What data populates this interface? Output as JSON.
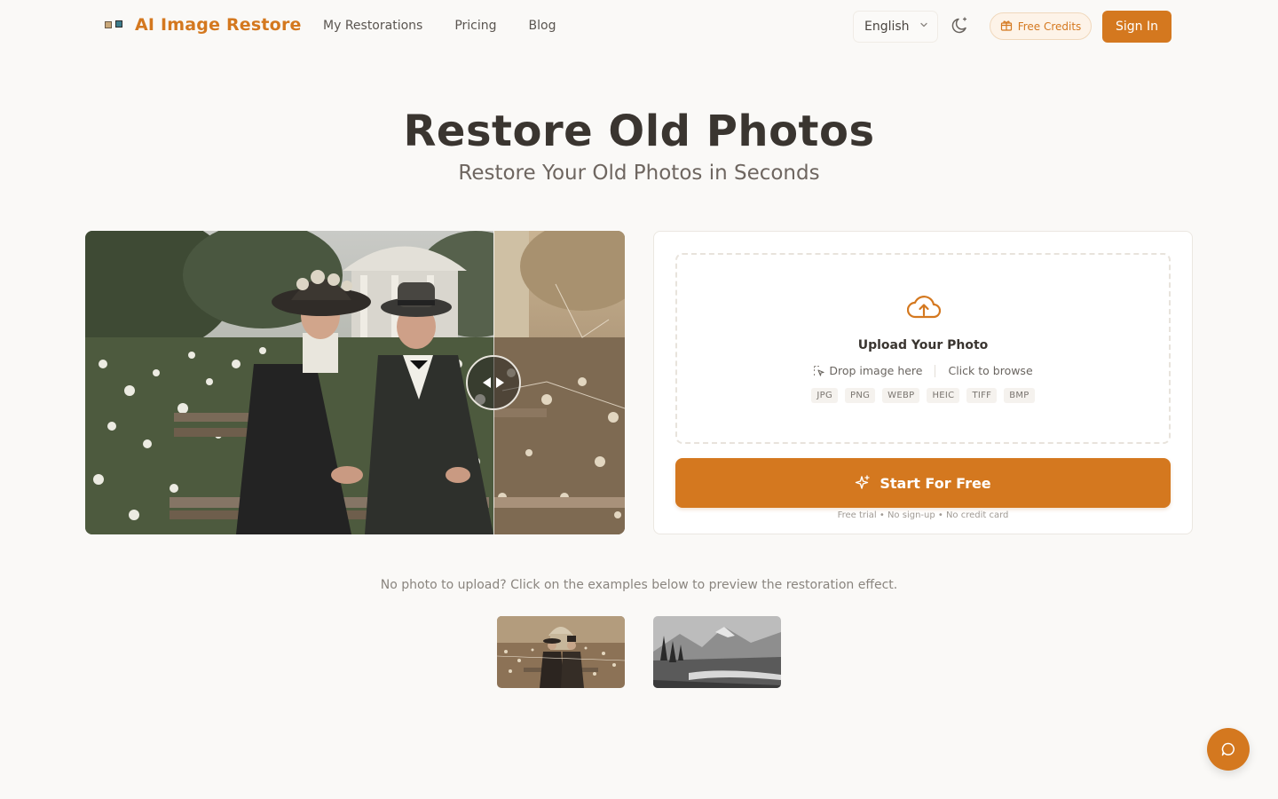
{
  "brand": {
    "name": "AI Image Restore",
    "accent": "#d4781f"
  },
  "nav": [
    {
      "label": "My Restorations"
    },
    {
      "label": "Pricing"
    },
    {
      "label": "Blog"
    }
  ],
  "header": {
    "language": "English",
    "free_credits": "Free Credits",
    "sign_in": "Sign In"
  },
  "hero": {
    "title": "Restore Old Photos",
    "subtitle": "Restore Your Old Photos in Seconds"
  },
  "upload": {
    "title": "Upload Your Photo",
    "drop": "Drop image here",
    "browse": "Click to browse",
    "formats": [
      "JPG",
      "PNG",
      "WEBP",
      "HEIC",
      "TIFF",
      "BMP"
    ],
    "start_label": "Start For Free",
    "fine_print": "Free trial • No sign-up • No credit card"
  },
  "examples": {
    "hint": "No photo to upload? Click on the examples below to preview the restoration effect."
  }
}
